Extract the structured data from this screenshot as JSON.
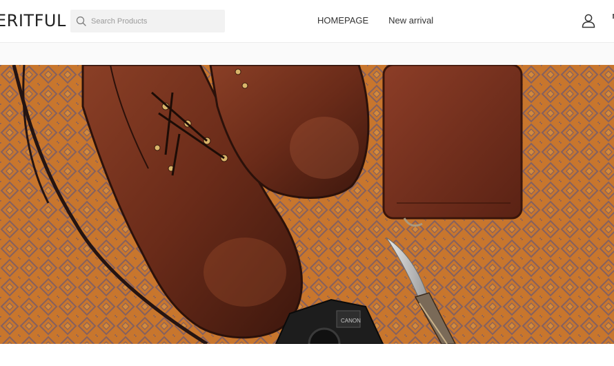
{
  "header": {
    "logo": "ERITFUL",
    "search": {
      "placeholder": "Search Products",
      "value": ""
    },
    "nav": [
      {
        "label": "HOMEPAGE"
      },
      {
        "label": "New arrival"
      }
    ],
    "icons": {
      "search": "search-icon",
      "account": "user-icon"
    }
  },
  "hero": {
    "image": "hero-banner-image",
    "colors": {
      "rug": "#c7782f",
      "leather": "#6e2f1c",
      "pattern": "#7b6a7a"
    },
    "camera_brand": "CANON"
  }
}
